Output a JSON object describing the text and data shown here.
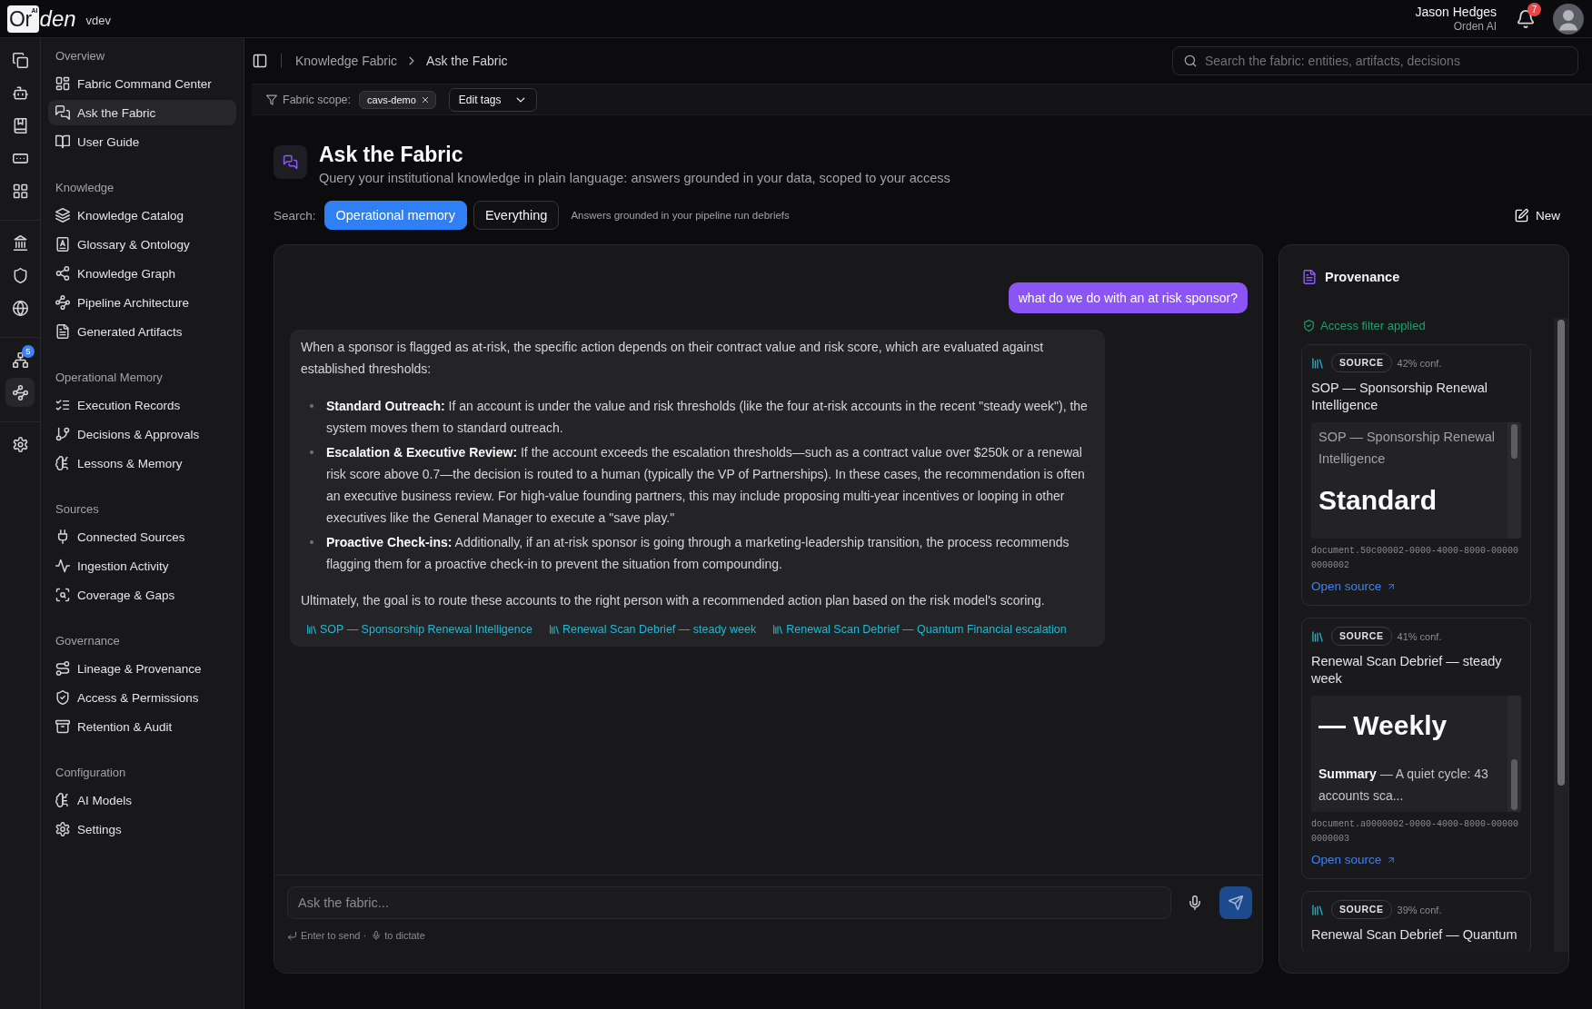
{
  "topbar": {
    "logo": {
      "tile_letters": "Or",
      "tag": "AI",
      "rest": "den"
    },
    "environment": "vdev",
    "user": {
      "name": "Jason Hedges",
      "org": "Orden AI"
    },
    "notifications": {
      "count": "7"
    }
  },
  "rail": {
    "groups": [
      [
        {
          "selected": false
        },
        {
          "selected": false
        },
        {
          "selected": false
        },
        {
          "selected": false
        },
        {
          "selected": false
        }
      ],
      [
        {
          "selected": false
        },
        {
          "selected": false
        },
        {
          "selected": false
        }
      ],
      [
        {
          "selected": false,
          "badge": "5"
        },
        {
          "selected": true
        }
      ],
      [
        {
          "selected": false
        }
      ]
    ]
  },
  "sidebar": {
    "sections": [
      {
        "title": "Overview",
        "items": [
          {
            "label": "Fabric Command Center",
            "selected": false
          },
          {
            "label": "Ask the Fabric",
            "selected": true
          },
          {
            "label": "User Guide",
            "selected": false
          }
        ]
      },
      {
        "title": "Knowledge",
        "items": [
          {
            "label": "Knowledge Catalog",
            "selected": false
          },
          {
            "label": "Glossary & Ontology",
            "selected": false
          },
          {
            "label": "Knowledge Graph",
            "selected": false
          },
          {
            "label": "Pipeline Architecture",
            "selected": false
          },
          {
            "label": "Generated Artifacts",
            "selected": false
          }
        ]
      },
      {
        "title": "Operational Memory",
        "items": [
          {
            "label": "Execution Records",
            "selected": false
          },
          {
            "label": "Decisions & Approvals",
            "selected": false
          },
          {
            "label": "Lessons & Memory",
            "selected": false
          }
        ]
      },
      {
        "title": "Sources",
        "items": [
          {
            "label": "Connected Sources",
            "selected": false
          },
          {
            "label": "Ingestion Activity",
            "selected": false
          },
          {
            "label": "Coverage & Gaps",
            "selected": false
          }
        ]
      },
      {
        "title": "Governance",
        "items": [
          {
            "label": "Lineage & Provenance",
            "selected": false
          },
          {
            "label": "Access & Permissions",
            "selected": false
          },
          {
            "label": "Retention & Audit",
            "selected": false
          }
        ]
      },
      {
        "title": "Configuration",
        "items": [
          {
            "label": "AI Models",
            "selected": false
          },
          {
            "label": "Settings",
            "selected": false
          }
        ]
      }
    ]
  },
  "breadcrumb": [
    "Knowledge Fabric",
    "Ask the Fabric"
  ],
  "global_search": {
    "placeholder": "Search the fabric: entities, artifacts, decisions"
  },
  "scope_bar": {
    "label": "Fabric scope:",
    "tags": [
      {
        "label": "cavs-demo"
      }
    ],
    "edit_button": "Edit tags"
  },
  "page": {
    "title": "Ask the Fabric",
    "subtitle": "Query your institutional knowledge in plain language: answers grounded in your data, scoped to your access"
  },
  "search_mode": {
    "label": "Search:",
    "options": [
      {
        "label": "Operational memory",
        "selected": true
      },
      {
        "label": "Everything",
        "selected": false
      }
    ],
    "hint": "Answers grounded in your pipeline run debriefs",
    "new_button": "New"
  },
  "chat": {
    "messages": [
      {
        "kind": "user",
        "text": "what do we do with an at risk sponsor?"
      },
      {
        "kind": "assistant",
        "intro": "When a sponsor is flagged as at-risk, the specific action depends on their contract value and risk score, which are evaluated against established thresholds:",
        "bullets": [
          "**Standard Outreach:** If an account is under the value and risk thresholds (like the four at-risk accounts in the recent \"steady week\"), the system moves them to standard outreach.",
          "**Escalation & Executive Review:** If the account exceeds the escalation thresholds—such as a contract value over $250k or a renewal risk score above 0.7—the decision is routed to a human (typically the VP of Partnerships). In these cases, the recommendation is often an executive business review. For high-value founding partners, this may include proposing multi-year incentives or looping in other executives like the General Manager to execute a \"save play.\"",
          "**Proactive Check-ins:** Additionally, if an at-risk sponsor is going through a marketing-leadership transition, the process recommends flagging them for a proactive check-in to prevent the situation from compounding."
        ],
        "conclusion": "Ultimately, the goal is to route these accounts to the right person with a recommended action plan based on the risk model's scoring.",
        "citations": [
          "SOP — Sponsorship Renewal Intelligence",
          "Renewal Scan Debrief — steady week",
          "Renewal Scan Debrief — Quantum Financial escalation"
        ]
      }
    ]
  },
  "composer": {
    "placeholder": "Ask the fabric...",
    "hint_send": "Enter to send ·",
    "hint_dictate": "to dictate"
  },
  "provenance": {
    "title": "Provenance",
    "access_note": "Access filter applied",
    "sources": [
      {
        "tag": "SOURCE",
        "confidence": "42% conf.",
        "title": "SOP — Sponsorship Renewal Intelligence",
        "preview": {
          "caption": "SOP — Sponsorship Renewal Intelligence",
          "heading": "Standard"
        },
        "document": "document.50c00002-0000-4000-8000-000000000002",
        "link": "Open source"
      },
      {
        "tag": "SOURCE",
        "confidence": "41% conf.",
        "title": "Renewal Scan Debrief — steady week",
        "preview": {
          "heading": "— Weekly",
          "summary": "**Summary** — A quiet cycle: 43 accounts sca..."
        },
        "document": "document.a0000002-0000-4000-8000-000000000003",
        "link": "Open source"
      },
      {
        "tag": "SOURCE",
        "confidence": "39% conf.",
        "title": "Renewal Scan Debrief — Quantum"
      }
    ]
  }
}
